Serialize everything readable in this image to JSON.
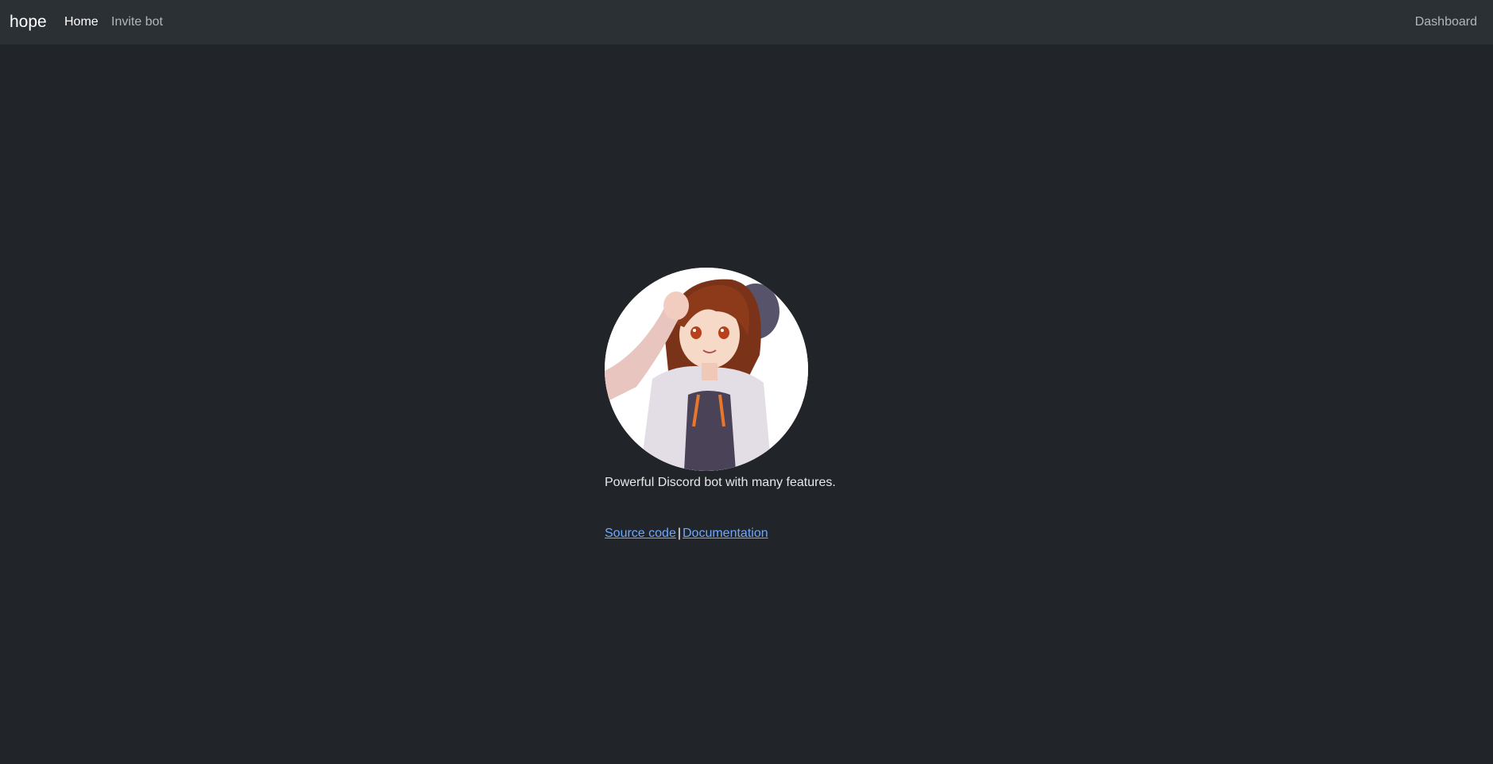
{
  "navbar": {
    "brand": "hope",
    "items": [
      {
        "label": "Home",
        "active": true
      },
      {
        "label": "Invite bot",
        "active": false
      }
    ],
    "right_item": "Dashboard"
  },
  "main": {
    "avatar_alt": "bot avatar",
    "tagline": "Powerful Discord bot with many features.",
    "links": [
      {
        "label": "Source code"
      },
      {
        "label": "Documentation"
      }
    ],
    "separator": "|"
  },
  "colors": {
    "background": "#212429",
    "navbar": "#2b3035",
    "link": "#6ea8fe"
  }
}
